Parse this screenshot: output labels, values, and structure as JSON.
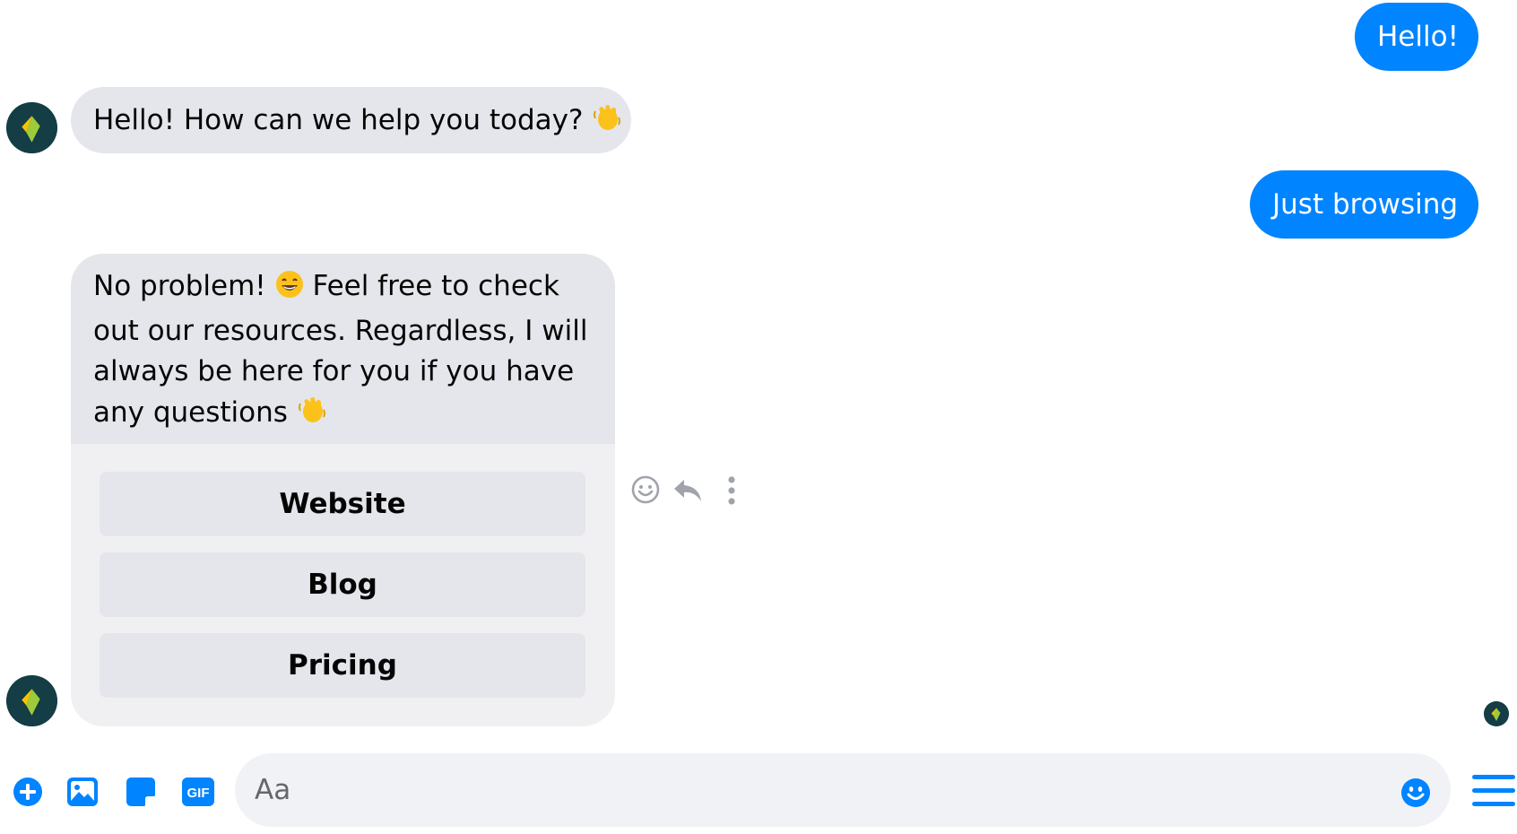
{
  "colors": {
    "accent": "#0084ff",
    "incoming_bubble": "#e4e6eb",
    "outgoing_text": "#ffffff",
    "avatar_bg": "#143d46"
  },
  "messages": {
    "outgoing_1": "Hello!",
    "incoming_1": "Hello! How can we help you today?",
    "outgoing_2": "Just browsing",
    "incoming_2_part1": "No problem!",
    "incoming_2_part2": "Feel free to check out our resources. Regardless, I will always be here for you if you have any questions"
  },
  "quick_replies": [
    "Website",
    "Blog",
    "Pricing"
  ],
  "message_actions": [
    "smile-icon",
    "reply-icon",
    "more-icon"
  ],
  "composer": {
    "placeholder": "Aa",
    "tools": [
      "plus-icon",
      "image-icon",
      "sticker-icon",
      "gif-icon"
    ],
    "gif_label": "GIF",
    "emoji_button": "smile-icon",
    "menu_button": "menu-icon"
  }
}
